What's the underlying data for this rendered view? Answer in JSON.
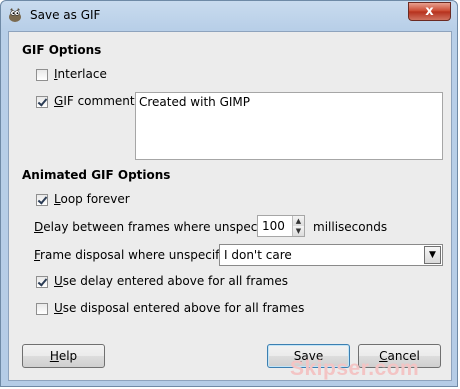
{
  "window": {
    "title": "Save as GIF",
    "close_label": "x",
    "app_icon": "gimp-wilber-icon"
  },
  "gif_options": {
    "heading": "GIF Options",
    "interlace": {
      "label_mnemonic": "I",
      "label_rest": "nterlace",
      "checked": false
    },
    "comment": {
      "label_mnemonic": "G",
      "label_rest": "IF comment:",
      "checked": true,
      "value": "Created with GIMP"
    }
  },
  "animated_options": {
    "heading": "Animated GIF Options",
    "loop_forever": {
      "label_mnemonic": "L",
      "label_rest": "oop forever",
      "checked": true
    },
    "delay": {
      "label_mnemonic": "D",
      "label_rest": "elay between frames where unspecified:",
      "value": "100",
      "unit": "milliseconds"
    },
    "disposal": {
      "label_mnemonic": "F",
      "label_rest": "rame disposal where unspecified:",
      "selected": "I don't care"
    },
    "use_delay": {
      "label_mnemonic": "U",
      "label_rest": "se delay entered above for all frames",
      "checked": true
    },
    "use_disposal": {
      "label_mnemonic": "U",
      "label_rest": "se disposal entered above for all frames",
      "checked": false
    }
  },
  "buttons": {
    "help_mnemonic": "H",
    "help_rest": "elp",
    "save_mnemonic": "S",
    "save_rest": "ave",
    "cancel_mnemonic": "C",
    "cancel_rest": "ancel"
  },
  "watermark": "Skipser.com"
}
